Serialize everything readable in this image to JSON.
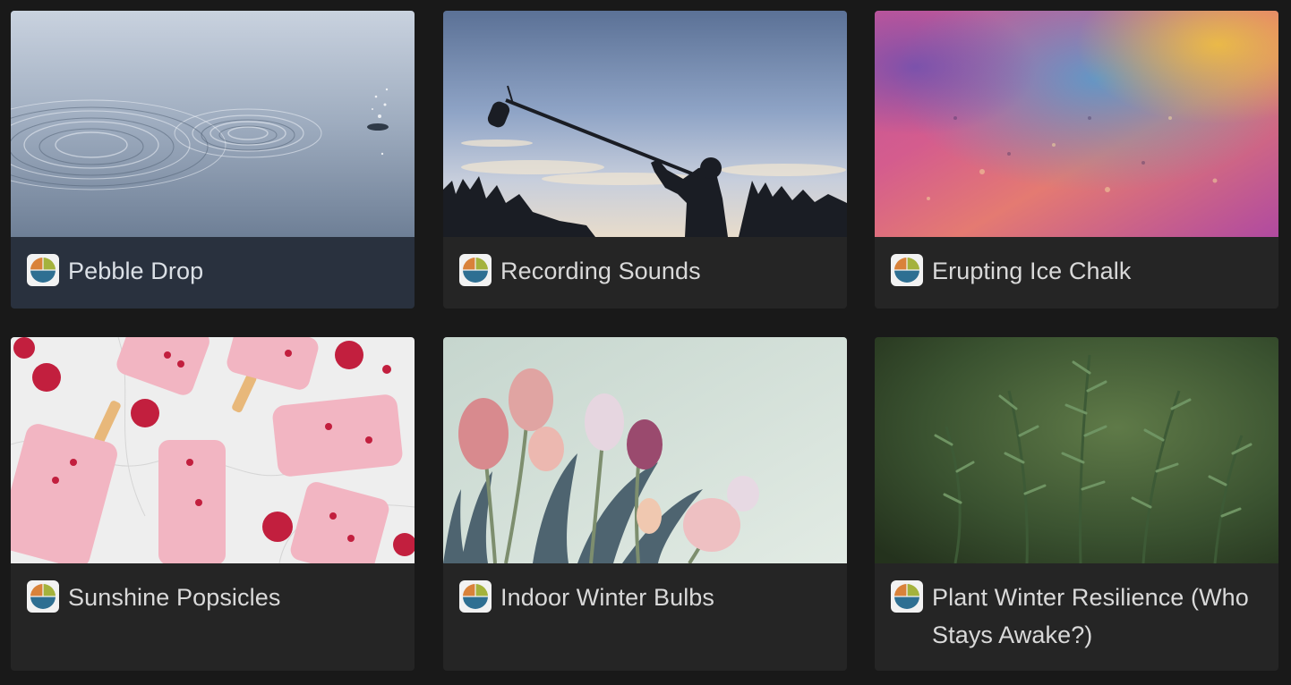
{
  "gallery": {
    "cards": [
      {
        "title": "Pebble Drop",
        "cover": "water-ripple-photo",
        "icon": "season-circle-icon",
        "selected": true
      },
      {
        "title": "Recording Sounds",
        "cover": "boom-microphone-silhouette-photo",
        "icon": "season-circle-icon"
      },
      {
        "title": "Erupting Ice Chalk",
        "cover": "colorful-chalk-powder-photo",
        "icon": "season-circle-icon"
      },
      {
        "title": "Sunshine Popsicles",
        "cover": "raspberry-popsicles-photo",
        "icon": "season-circle-icon"
      },
      {
        "title": "Indoor Winter Bulbs",
        "cover": "tulips-photo",
        "icon": "season-circle-icon"
      },
      {
        "title": "Plant Winter Resilience (Who Stays Awake?)",
        "cover": "rosemary-plant-photo",
        "icon": "season-circle-icon"
      }
    ]
  },
  "colors": {
    "background": "#191919",
    "card": "#252525",
    "card_selected": "#29313e",
    "text": "#d9d9d9"
  }
}
